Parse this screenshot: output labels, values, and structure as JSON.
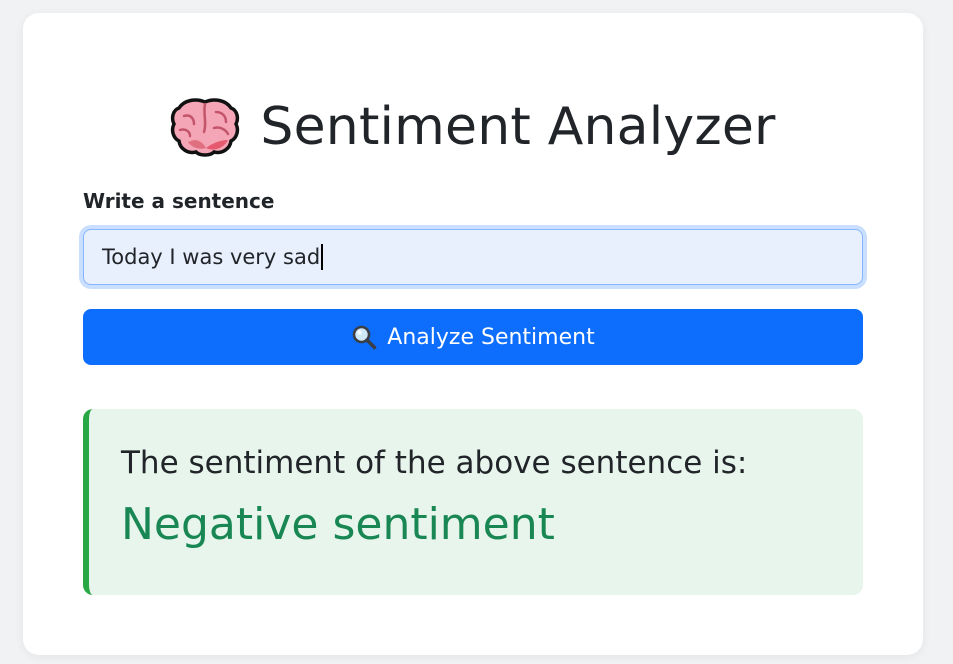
{
  "header": {
    "icon": "brain-icon",
    "title": "Sentiment Analyzer"
  },
  "form": {
    "label": "Write a sentence",
    "input_value": "Today I was very sad",
    "button_icon": "search-icon",
    "button_label": "Analyze Sentiment"
  },
  "result": {
    "heading": "The sentiment of the above sentence is:",
    "value": "Negative sentiment"
  },
  "colors": {
    "primary": "#0d6efd",
    "success_text": "#198754",
    "success_border": "#28a745",
    "result_bg": "#e8f5ec",
    "input_bg": "#e8f0fe"
  }
}
